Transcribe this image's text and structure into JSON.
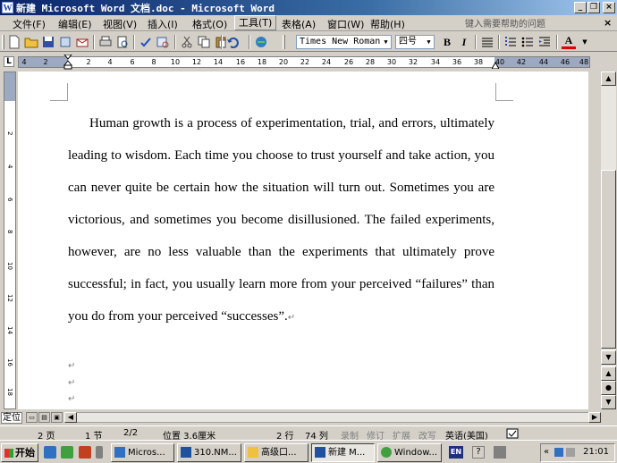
{
  "titlebar": {
    "title": "新建 Microsoft Word 文档.doc - Microsoft Word",
    "minimize": "_",
    "maximize": "❐",
    "close": "×"
  },
  "menu": {
    "items": [
      "文件(F)",
      "编辑(E)",
      "视图(V)",
      "插入(I)",
      "格式(O)",
      "工具(T)",
      "表格(A)",
      "窗口(W)",
      "帮助(H)"
    ],
    "help_placeholder": "键入需要帮助的问题",
    "doc_close": "×"
  },
  "toolbar": {
    "font_name": "Times New Roman",
    "font_size": "四号",
    "bold": "B",
    "italic": "I",
    "font_color_label": "A"
  },
  "ruler": {
    "corner": "L",
    "numbers": [
      "4",
      "2",
      "2",
      "4",
      "6",
      "8",
      "10",
      "12",
      "14",
      "16",
      "18",
      "20",
      "22",
      "24",
      "26",
      "28",
      "30",
      "32",
      "34",
      "36",
      "38",
      "40",
      "42",
      "44",
      "46",
      "48"
    ],
    "vnumbers": [
      "2",
      "4",
      "6",
      "8",
      "10",
      "12",
      "14",
      "16",
      "18"
    ]
  },
  "document": {
    "paragraph": "Human growth is a process of experimentation, trial, and errors, ultimately leading to wisdom. Each time you choose to trust yourself and take action, you can never quite be certain how the situation will turn out. Sometimes you are victorious, and sometimes you become disillusioned. The failed experiments, however, are no less valuable than the experiments that ultimately prove successful; in fact, you usually learn more from your perceived “failures” than you do from your perceived “successes”.",
    "para_mark": "↵"
  },
  "view": {
    "label": "定位"
  },
  "status": {
    "page": "2 页",
    "section": "1 节",
    "pages": "2/2",
    "position": "位置 3.6厘米",
    "line": "2 行",
    "column": "74 列",
    "rec": "录制",
    "trk": "修订",
    "ext": "扩展",
    "ovr": "改写",
    "language": "英语(美国)"
  },
  "taskbar": {
    "start": "开始",
    "tasks": [
      "Micros...",
      "310.NM...",
      "高级口...",
      "新建 M...",
      "Window..."
    ],
    "ime": "EN",
    "clock": "21:01"
  },
  "colors": {
    "titlebar_start": "#0a246a",
    "titlebar_end": "#a6caf0",
    "face": "#d4d0c8",
    "font_color": "#e00000"
  }
}
